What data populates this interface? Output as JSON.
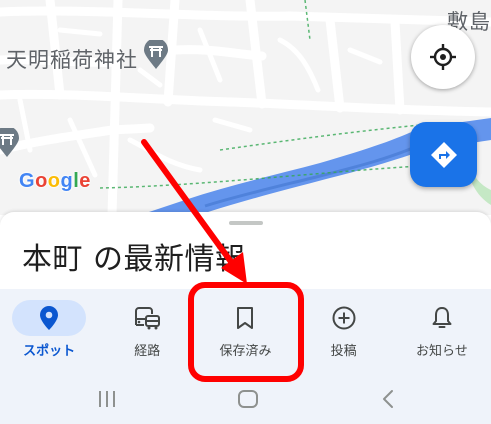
{
  "map": {
    "labels": {
      "shrine": "天明稲荷神社",
      "district": "敷島"
    },
    "google_logo": [
      "G",
      "o",
      "o",
      "g",
      "l",
      "e"
    ],
    "google_colors": [
      "#4285F4",
      "#EA4335",
      "#FBBC05",
      "#4285F4",
      "#34A853",
      "#EA4335"
    ],
    "colors": {
      "river": "#6495ed",
      "road": "#ffffff",
      "background": "#f4f4f4",
      "poi": "#6d7a85",
      "trail": "#34a853"
    }
  },
  "sheet": {
    "title": "本町 の最新情報"
  },
  "bottom_nav": {
    "items": [
      {
        "label": "スポット",
        "icon": "place-pin-icon",
        "active": true
      },
      {
        "label": "経路",
        "icon": "commute-icon",
        "active": false
      },
      {
        "label": "保存済み",
        "icon": "bookmark-icon",
        "active": false
      },
      {
        "label": "投稿",
        "icon": "add-circle-icon",
        "active": false
      },
      {
        "label": "お知らせ",
        "icon": "bell-icon",
        "active": false
      }
    ],
    "colors": {
      "active": "#0b57d0",
      "active_pill": "#d3e3fd",
      "inactive": "#444746"
    }
  },
  "system_nav": {
    "buttons": [
      "recents-icon",
      "home-icon",
      "back-icon"
    ]
  },
  "annotation": {
    "color": "#ff0000",
    "highlight_target": "保存済み"
  }
}
